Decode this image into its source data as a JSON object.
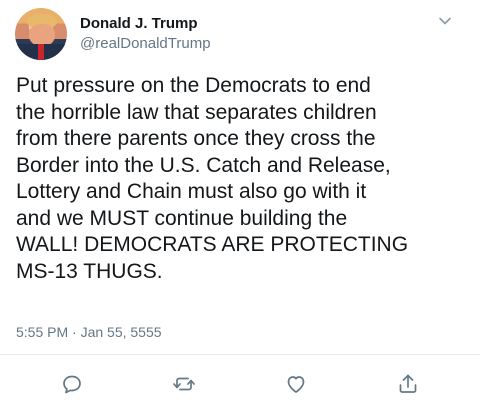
{
  "author": {
    "name": "Donald J. Trump",
    "handle": "@realDonaldTrump"
  },
  "tweet": {
    "text": "Put pressure on the Democrats to end\nthe horrible law that separates children\nfrom there parents once they cross the\nBorder into the U.S. Catch and Release,\nLottery and Chain must also go with it\nand we MUST continue building the\nWALL! DEMOCRATS ARE PROTECTING\nMS-13 THUGS.",
    "timestamp": "5:55 PM · Jan 55, 5555"
  },
  "icons": {
    "menu": "chevron-down-icon",
    "reply": "reply-icon",
    "retweet": "retweet-icon",
    "like": "heart-icon",
    "share": "share-icon"
  },
  "colors": {
    "text": "#14171a",
    "secondary": "#657786",
    "icon": "#657786",
    "divider": "#e6ecf0"
  }
}
